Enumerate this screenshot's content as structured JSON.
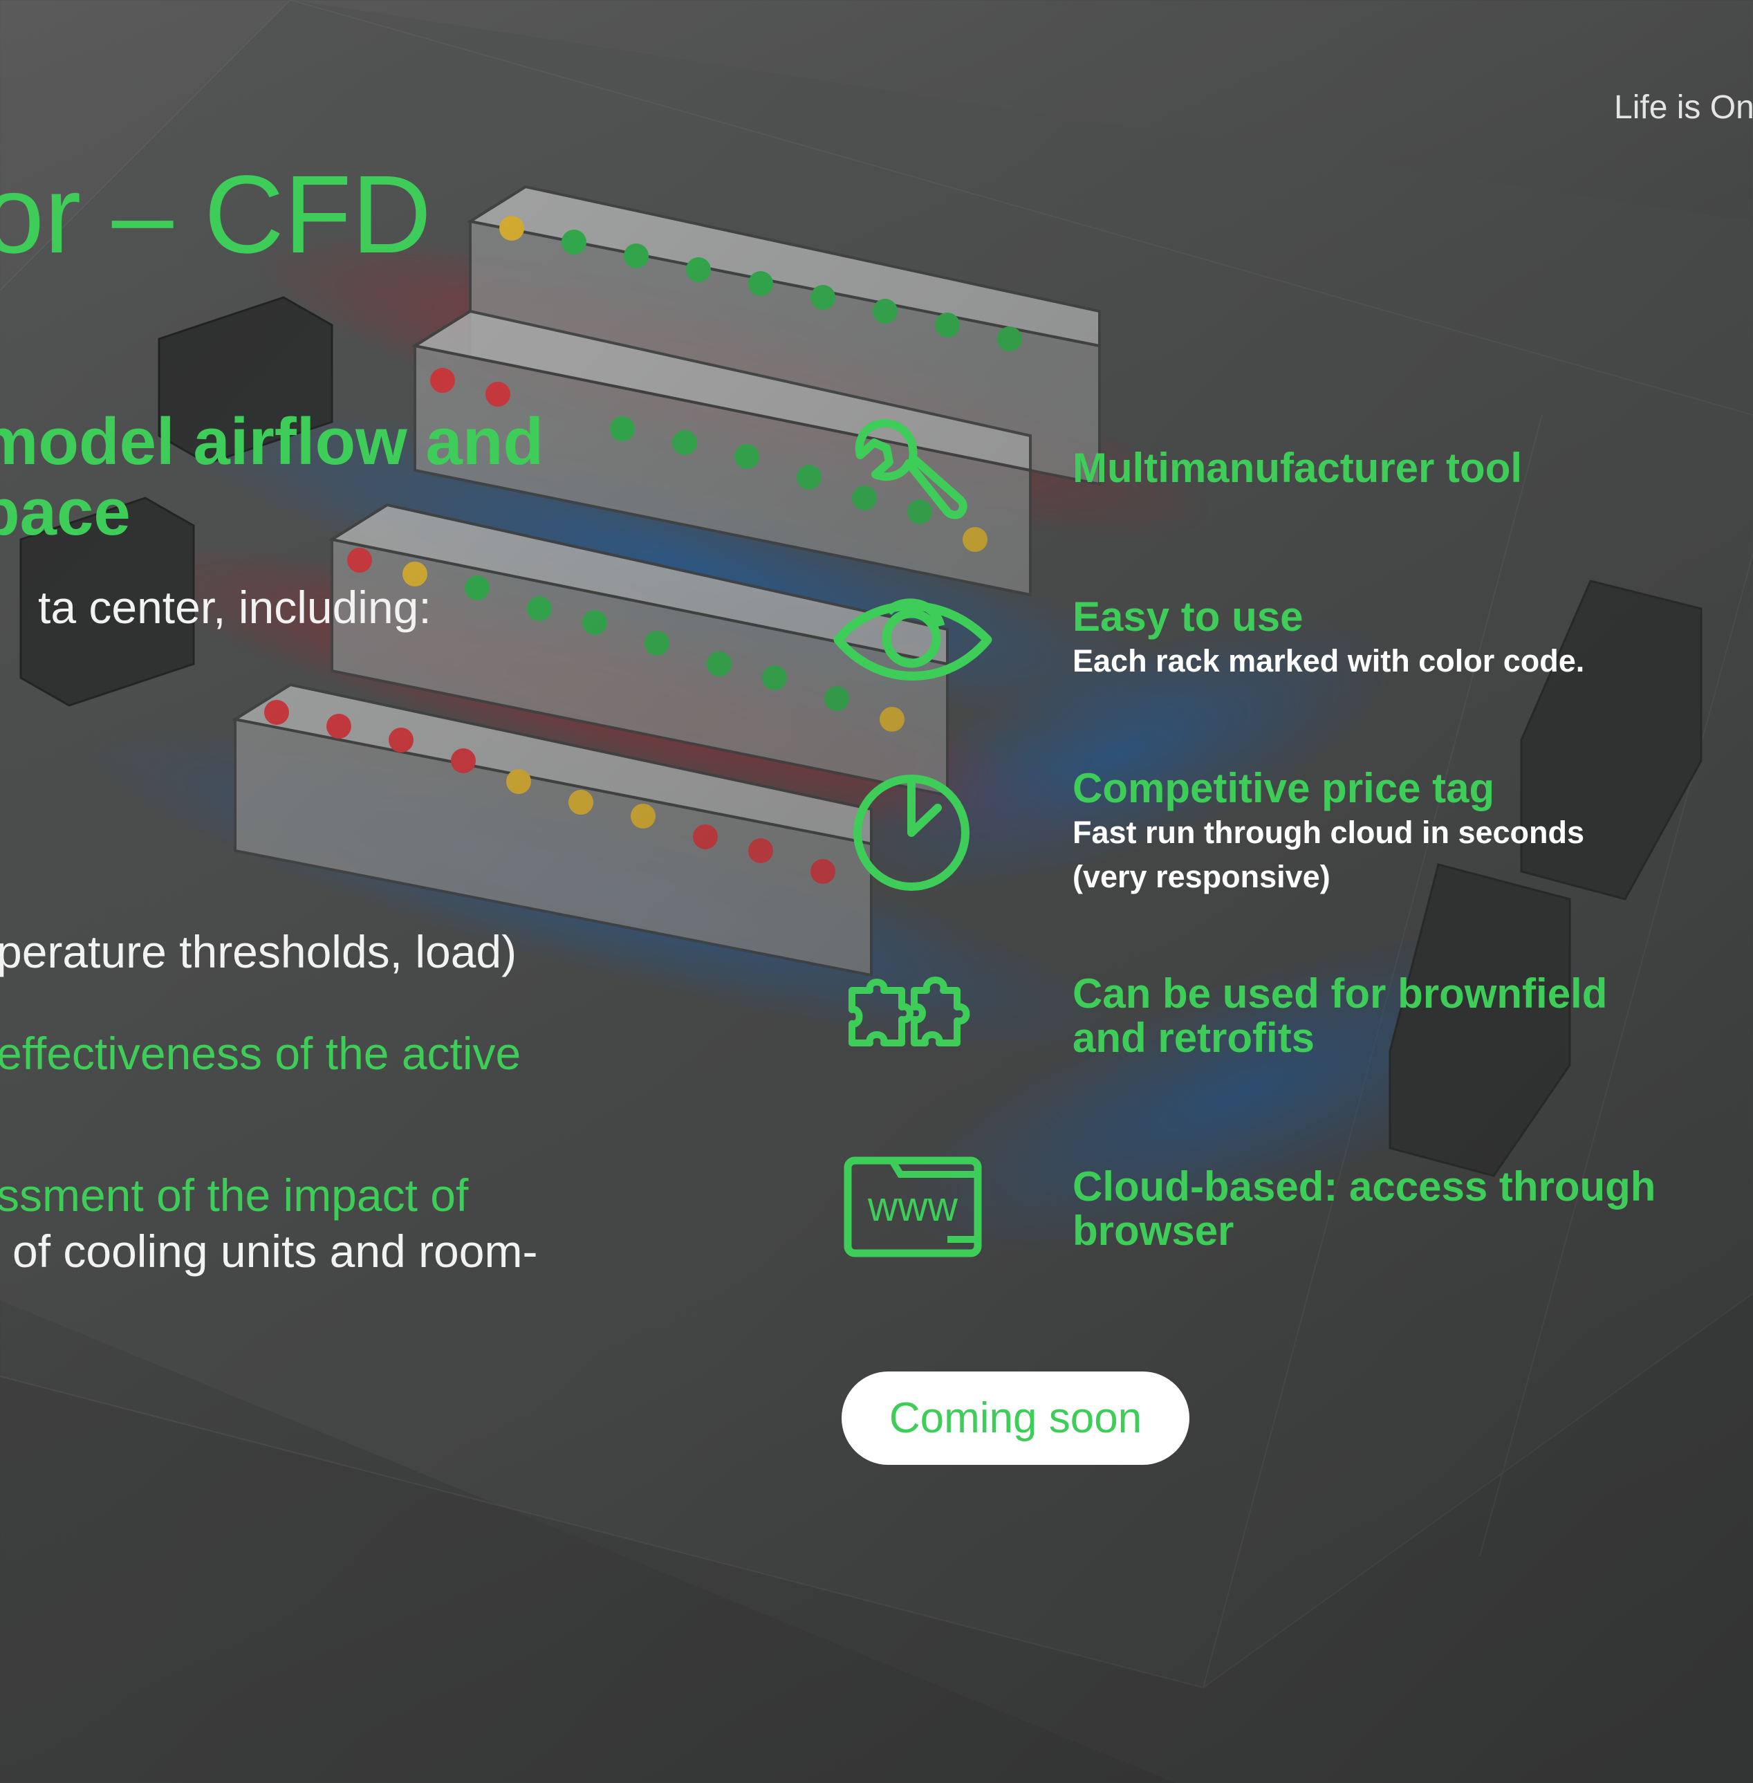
{
  "brand": {
    "tagline": "Life is On"
  },
  "slide": {
    "title": "or – CFD",
    "subtitle_lines": [
      "model airflow and",
      "pace"
    ]
  },
  "left_text": {
    "intro": "ta center, including:",
    "line_1": "perature thresholds, load)",
    "line_2": "effectiveness of the active",
    "line_3": "ssment of the impact of",
    "line_4": "of cooling units and room-"
  },
  "features": [
    {
      "icon": "wrench-icon",
      "title": "Multimanufacturer tool"
    },
    {
      "icon": "eye-icon",
      "title": "Easy to use",
      "description": "Each rack marked with color code."
    },
    {
      "icon": "clock-icon",
      "title": "Competitive price tag",
      "description_lines": [
        "Fast run through cloud in seconds",
        "(very responsive)"
      ]
    },
    {
      "icon": "puzzle-icon",
      "title_lines": [
        "Can be used for brownfield",
        "and retrofits"
      ]
    },
    {
      "icon": "browser-www-icon",
      "title_lines": [
        "Cloud-based: access through",
        "browser"
      ],
      "icon_text": "www"
    }
  ],
  "cta": {
    "label": "Coming soon"
  },
  "colors": {
    "accent": "#3dcd58",
    "text": "#ffffff",
    "background": "#4a4b4b"
  },
  "background_image": "data-center-cfd-airflow-render"
}
